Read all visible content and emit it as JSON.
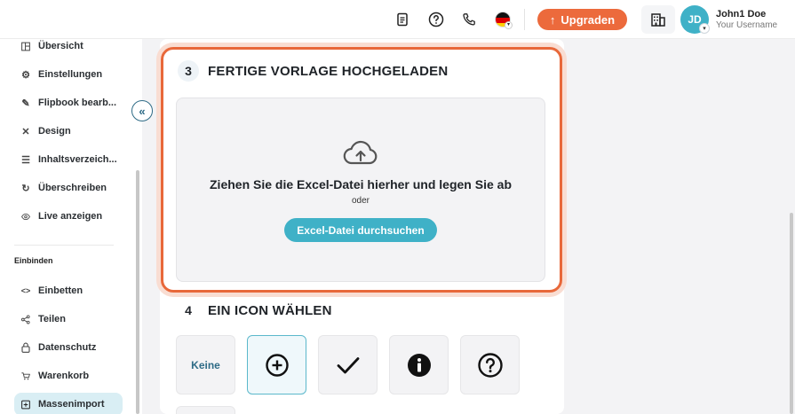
{
  "topbar": {
    "upgrade_label": "Upgraden",
    "avatar_initials": "JD",
    "user_name": "John1 Doe",
    "user_subtitle": "Your Username",
    "icons": [
      "document-icon",
      "help-icon",
      "phone-icon",
      "german-flag-icon",
      "building-icon"
    ]
  },
  "sidebar": {
    "items": [
      {
        "label": "Übersicht",
        "icon": "layout-icon"
      },
      {
        "label": "Einstellungen",
        "icon": "gear-icon"
      },
      {
        "label": "Flipbook bearb...",
        "icon": "pencil-icon"
      },
      {
        "label": "Design",
        "icon": "tools-icon"
      },
      {
        "label": "Inhaltsverzeich...",
        "icon": "list-icon"
      },
      {
        "label": "Überschreiben",
        "icon": "refresh-icon"
      },
      {
        "label": "Live anzeigen",
        "icon": "eye-icon"
      }
    ],
    "section_label": "Einbinden",
    "embed_items": [
      {
        "label": "Einbetten",
        "icon": "code-icon"
      },
      {
        "label": "Teilen",
        "icon": "share-icon"
      },
      {
        "label": "Datenschutz",
        "icon": "lock-icon"
      },
      {
        "label": "Warenkorb",
        "icon": "cart-icon"
      },
      {
        "label": "Massenimport",
        "icon": "import-icon",
        "active": true
      }
    ],
    "collapse_glyph": "«"
  },
  "main": {
    "step3": {
      "number": "3",
      "title": "FERTIGE VORLAGE HOCHGELADEN",
      "drop_text": "Ziehen Sie die Excel-Datei hierher und legen Sie ab",
      "or_text": "oder",
      "browse_label": "Excel-Datei durchsuchen"
    },
    "step4": {
      "number": "4",
      "title": "EIN ICON WÄHLEN",
      "options": [
        {
          "label": "Keine",
          "icon": "none"
        },
        {
          "icon": "plus-circle-icon",
          "selected": true
        },
        {
          "icon": "checkmark-icon"
        },
        {
          "icon": "info-icon"
        },
        {
          "icon": "question-circle-icon"
        }
      ]
    }
  },
  "colors": {
    "accent": "#3fb1c7",
    "upgrade": "#ec6a3c",
    "highlight": "#e8683a",
    "dark_teal": "#2e6b86"
  }
}
